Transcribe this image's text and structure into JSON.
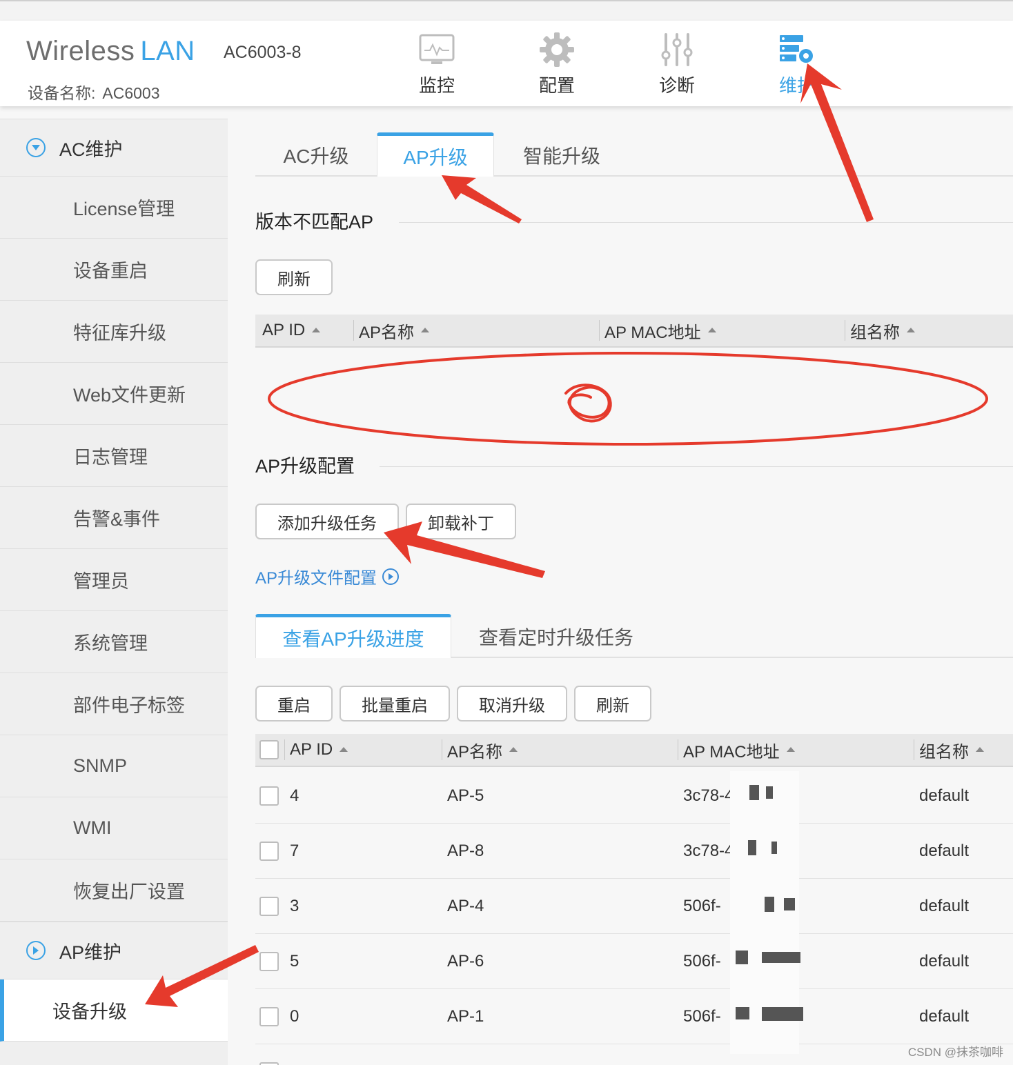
{
  "header": {
    "brand_left": "Wireless",
    "brand_right": "LAN",
    "model": "AC6003-8",
    "device_label": "设备名称:",
    "device_value": "AC6003",
    "nav": [
      {
        "label": "监控",
        "icon": "monitor-icon"
      },
      {
        "label": "配置",
        "icon": "gear-icon"
      },
      {
        "label": "诊断",
        "icon": "sliders-icon"
      },
      {
        "label": "维护",
        "icon": "server-gear-icon"
      }
    ]
  },
  "sidebar": {
    "group1": "AC维护",
    "items": [
      "License管理",
      "设备重启",
      "特征库升级",
      "Web文件更新",
      "日志管理",
      "告警&事件",
      "管理员",
      "系统管理",
      "部件电子标签",
      "SNMP",
      "WMI",
      "恢复出厂设置"
    ],
    "group2": "AP维护",
    "active_item": "设备升级"
  },
  "tabs": [
    "AC升级",
    "AP升级",
    "智能升级"
  ],
  "mismatch": {
    "title": "版本不匹配AP",
    "refresh": "刷新",
    "columns": [
      "AP ID",
      "AP名称",
      "AP MAC地址",
      "组名称"
    ]
  },
  "upgrade_config": {
    "title": "AP升级配置",
    "add_task": "添加升级任务",
    "uninstall_patch": "卸载补丁",
    "file_config_link": "AP升级文件配置"
  },
  "progress": {
    "subtabs": [
      "查看AP升级进度",
      "查看定时升级任务"
    ],
    "buttons": [
      "重启",
      "批量重启",
      "取消升级",
      "刷新"
    ],
    "columns": [
      "AP ID",
      "AP名称",
      "AP MAC地址",
      "组名称"
    ],
    "rows": [
      {
        "id": "4",
        "name": "AP-5",
        "mac": "3c78-43",
        "group": "default"
      },
      {
        "id": "7",
        "name": "AP-8",
        "mac": "3c78-4",
        "group": "default"
      },
      {
        "id": "3",
        "name": "AP-4",
        "mac": "506f-",
        "group": "default"
      },
      {
        "id": "5",
        "name": "AP-6",
        "mac": "506f-",
        "group": "default"
      },
      {
        "id": "0",
        "name": "AP-1",
        "mac": "506f-",
        "group": "default"
      }
    ]
  },
  "watermark": "CSDN @抹茶咖啡",
  "colors": {
    "accent": "#3aa2e5",
    "annotation": "#e53a2c"
  }
}
